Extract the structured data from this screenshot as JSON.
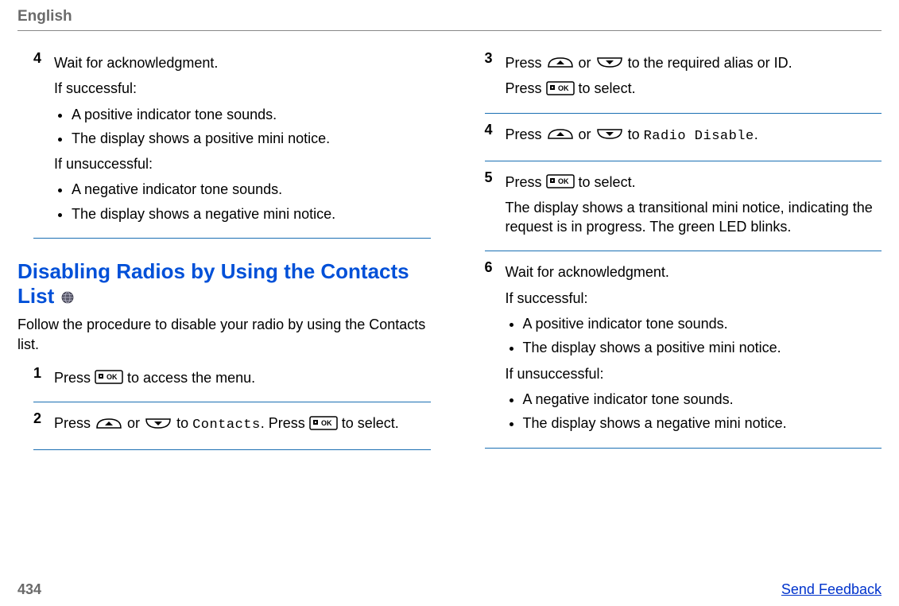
{
  "header": {
    "language": "English"
  },
  "left": {
    "step4": {
      "num": "4",
      "line1": "Wait for acknowledgment.",
      "if_success": "If successful:",
      "success_bullets": [
        "A positive indicator tone sounds.",
        "The display shows a positive mini notice."
      ],
      "if_unsuccess": "If unsuccessful:",
      "unsuccess_bullets": [
        "A negative indicator tone sounds.",
        "The display shows a negative mini notice."
      ]
    },
    "section": {
      "title": "Disabling Radios by Using the Contacts List",
      "intro": "Follow the procedure to disable your radio by using the Contacts list."
    },
    "step1": {
      "num": "1",
      "press": "Press ",
      "after_ok": " to access the menu."
    },
    "step2": {
      "num": "2",
      "press": "Press ",
      "or": " or ",
      "to": " to ",
      "contacts": "Contacts",
      "dot_press": ". Press ",
      "to_select": " to select."
    }
  },
  "right": {
    "step3": {
      "num": "3",
      "press": "Press ",
      "or": " or ",
      "to_required": " to the required alias or ID.",
      "press2": "Press ",
      "to_select": " to select."
    },
    "step4": {
      "num": "4",
      "press": "Press ",
      "or": " or ",
      "to": " to ",
      "radio_disable": "Radio Disable",
      "dot": "."
    },
    "step5": {
      "num": "5",
      "press": "Press ",
      "to_select": " to select.",
      "body": "The display shows a transitional mini notice, indicating the request is in progress. The green LED blinks."
    },
    "step6": {
      "num": "6",
      "line1": "Wait for acknowledgment.",
      "if_success": "If successful:",
      "success_bullets": [
        "A positive indicator tone sounds.",
        "The display shows a positive mini notice."
      ],
      "if_unsuccess": "If unsuccessful:",
      "unsuccess_bullets": [
        "A negative indicator tone sounds.",
        "The display shows a negative mini notice."
      ]
    }
  },
  "footer": {
    "page": "434",
    "feedback": "Send Feedback"
  }
}
